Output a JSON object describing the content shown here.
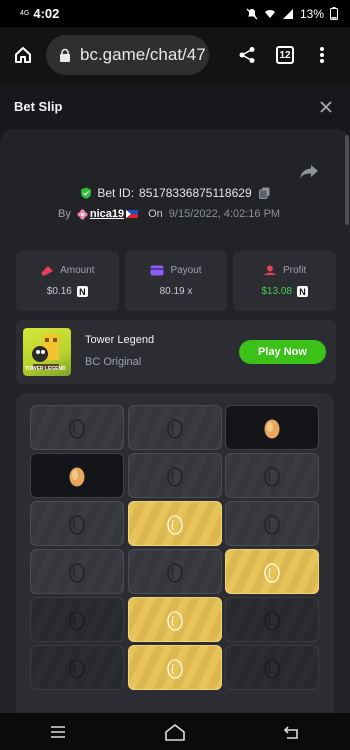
{
  "status_bar": {
    "network": "4G",
    "time": "4:02",
    "battery": "13%"
  },
  "browser": {
    "url": "bc.game/chat/47",
    "tab_count": "12"
  },
  "bet_slip": {
    "title": "Bet Slip",
    "bet_id_label": "Bet ID:",
    "bet_id": "85178336875118629",
    "by_label": "By",
    "username": "nica19",
    "on_label": "On",
    "date": "9/15/2022, 4:02:16 PM"
  },
  "stats": {
    "amount_label": "Amount",
    "amount_value": "$0.16",
    "payout_label": "Payout",
    "payout_value": "80.19 x",
    "profit_label": "Profit",
    "profit_value": "$13.08",
    "currency_badge": "N"
  },
  "game": {
    "name": "Tower Legend",
    "category": "BC Original",
    "play_label": "Play Now",
    "thumb_label": "TOWER LEGEND"
  },
  "tower_grid": [
    [
      "dark",
      "dark",
      "black-egg"
    ],
    [
      "black-egg",
      "dark",
      "dark"
    ],
    [
      "dark",
      "gold",
      "dark"
    ],
    [
      "dark",
      "dark",
      "gold"
    ],
    [
      "shade",
      "gold",
      "shade"
    ],
    [
      "shade",
      "gold",
      "shade"
    ]
  ],
  "colors": {
    "accent_green": "#3bc117",
    "profit_green": "#46d04a",
    "gold_tile": "#e7c35a"
  }
}
